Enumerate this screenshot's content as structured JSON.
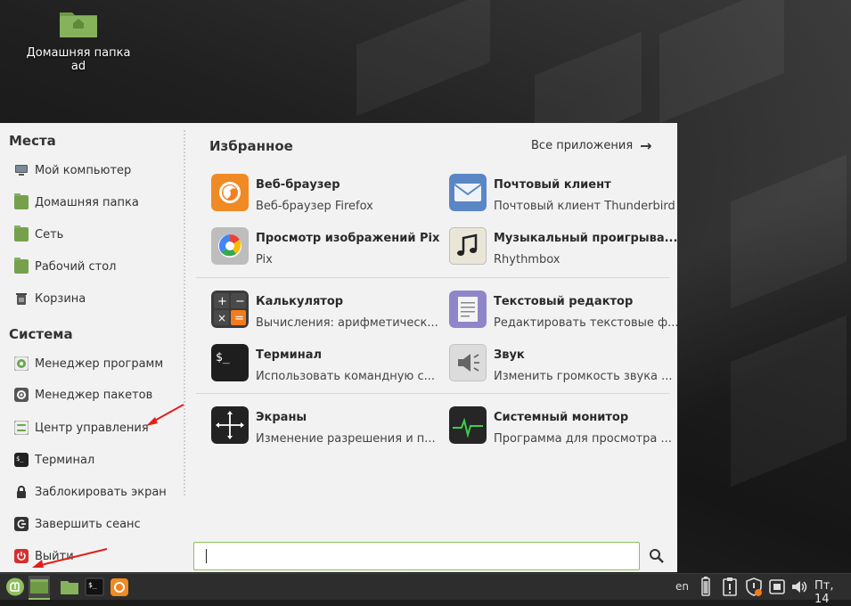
{
  "desktop": {
    "home_folder_label": "Домашняя папка ad"
  },
  "places": {
    "title": "Места",
    "items": [
      {
        "label": "Мой компьютер",
        "icon": "computer-icon"
      },
      {
        "label": "Домашняя папка",
        "icon": "home-folder-icon"
      },
      {
        "label": "Сеть",
        "icon": "network-folder-icon"
      },
      {
        "label": "Рабочий стол",
        "icon": "desktop-folder-icon"
      },
      {
        "label": "Корзина",
        "icon": "trash-icon"
      }
    ]
  },
  "system": {
    "title": "Система",
    "items": [
      {
        "label": "Менеджер программ",
        "icon": "software-manager-icon"
      },
      {
        "label": "Менеджер пакетов",
        "icon": "package-manager-icon"
      },
      {
        "label": "Центр управления",
        "icon": "control-center-icon"
      },
      {
        "label": "Терминал",
        "icon": "terminal-icon"
      },
      {
        "label": "Заблокировать экран",
        "icon": "lock-icon"
      },
      {
        "label": "Завершить сеанс",
        "icon": "logout-icon"
      },
      {
        "label": "Выйти",
        "icon": "power-icon"
      }
    ]
  },
  "favorites": {
    "title": "Избранное",
    "all_apps": "Все приложения",
    "apps": [
      {
        "title": "Веб-браузер",
        "desc": "Веб-браузер Firefox",
        "icon": "firefox-icon"
      },
      {
        "title": "Почтовый клиент",
        "desc": "Почтовый клиент Thunderbird",
        "icon": "mail-icon"
      },
      {
        "title": "Просмотр изображений Pix",
        "desc": "Pix",
        "icon": "image-viewer-icon"
      },
      {
        "title": "Музыкальный проигрыва...",
        "desc": "Rhythmbox",
        "icon": "music-player-icon"
      },
      {
        "title": "Калькулятор",
        "desc": "Вычисления: арифметическ...",
        "icon": "calculator-icon"
      },
      {
        "title": "Текстовый редактор",
        "desc": "Редактировать текстовые ф...",
        "icon": "text-editor-icon"
      },
      {
        "title": "Терминал",
        "desc": "Использовать командную с...",
        "icon": "terminal-icon"
      },
      {
        "title": "Звук",
        "desc": "Изменить громкость звука ...",
        "icon": "sound-icon"
      },
      {
        "title": "Экраны",
        "desc": "Изменение разрешения и п...",
        "icon": "displays-icon"
      },
      {
        "title": "Системный монитор",
        "desc": "Программа для просмотра ...",
        "icon": "system-monitor-icon"
      }
    ]
  },
  "search": {
    "value": ""
  },
  "panel": {
    "keyboard_layout": "en",
    "clock": "Пт, 14"
  },
  "colors": {
    "accent_green": "#8fbf5e",
    "annotation_arrow": "#e0201b",
    "menu_bg": "#f2f2f2",
    "panel_bg": "#2d2d2d"
  }
}
